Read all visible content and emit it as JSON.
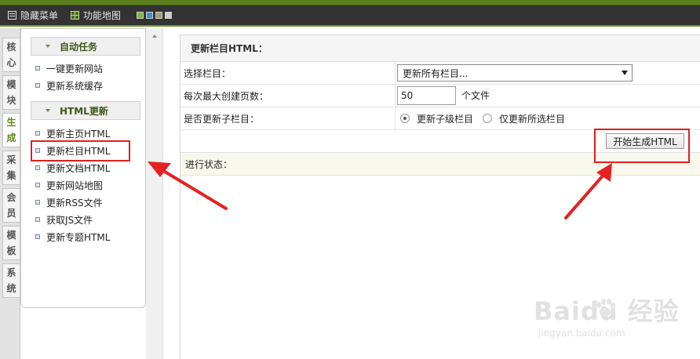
{
  "toolbar": {
    "hide_menu": "隐藏菜单",
    "function_map": "功能地图",
    "swatches": [
      "#7db83a",
      "#3d8fd6",
      "#a89b76",
      "#cfcfcf"
    ]
  },
  "vtabs": [
    "核心",
    "模块",
    "生成",
    "采集",
    "会员",
    "模板",
    "系统"
  ],
  "sidebar": {
    "section1": {
      "title": "自动任务",
      "items": [
        "一键更新网站",
        "更新系统缓存"
      ]
    },
    "section2": {
      "title": "HTML更新",
      "items": [
        "更新主页HTML",
        "更新栏目HTML",
        "更新文档HTML",
        "更新网站地图",
        "更新RSS文件",
        "获取JS文件",
        "更新专题HTML"
      ]
    }
  },
  "main": {
    "title": "更新栏目HTML：",
    "select_label": "选择栏目：",
    "select_value": "更新所有栏目...",
    "max_pages_label": "每次最大创建页数：",
    "max_pages_value": "50",
    "max_pages_unit": "个文件",
    "subcol_label": "是否更新子栏目：",
    "radio_opt1": "更新子级栏目",
    "radio_opt2": "仅更新所选栏目",
    "button_label": "开始生成HTML",
    "status_label": "进行状态："
  },
  "watermark": {
    "main": "Baidu 经验",
    "sub": "jingyan.baidu.com"
  }
}
